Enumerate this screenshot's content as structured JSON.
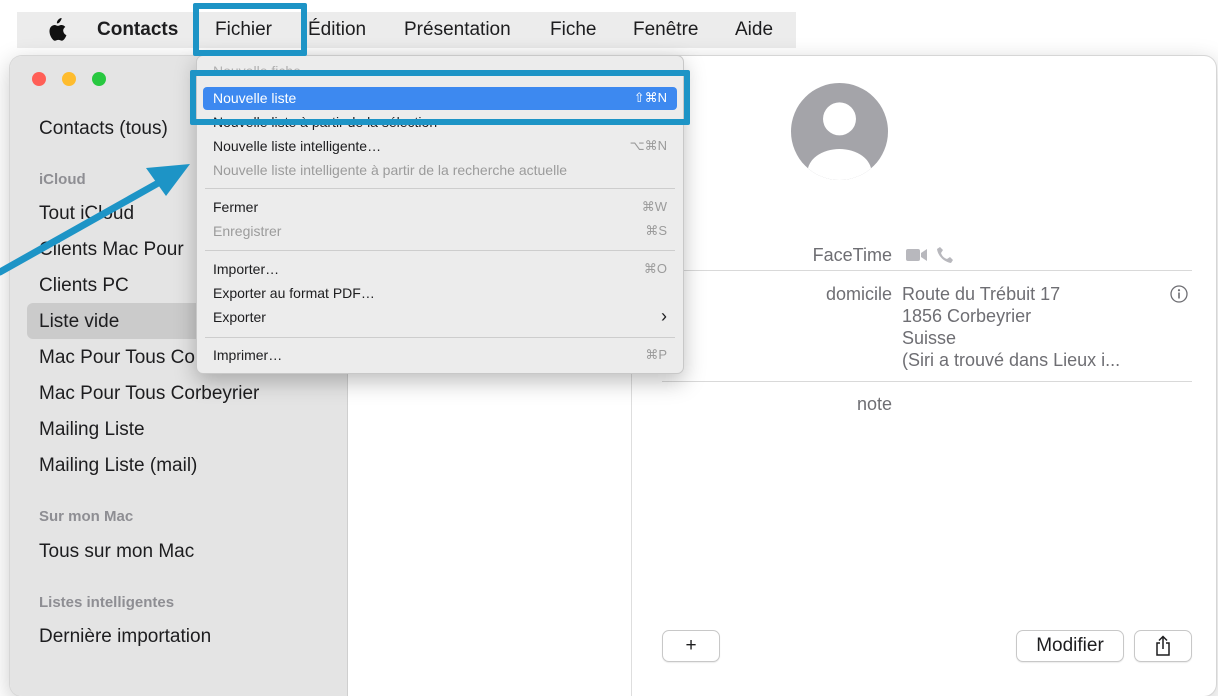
{
  "menubar": {
    "app_name": "Contacts",
    "items": [
      "Fichier",
      "Édition",
      "Présentation",
      "Fiche",
      "Fenêtre",
      "Aide"
    ]
  },
  "sidebar": {
    "all_contacts": "Contacts (tous)",
    "icloud_header": "iCloud",
    "icloud_items": [
      "Tout iCloud",
      "Clients Mac Pour",
      "Clients PC",
      "Liste vide",
      "Mac Pour Tous Co",
      "Mac Pour Tous Corbeyrier",
      "Mailing Liste",
      "Mailing Liste (mail)"
    ],
    "mac_header": "Sur mon Mac",
    "mac_items": [
      "Tous sur mon Mac"
    ],
    "smart_header": "Listes intelligentes",
    "smart_items": [
      "Dernière importation"
    ],
    "selected_item": "Liste vide"
  },
  "file_menu": {
    "hidden_top": "Nouvelle fiche",
    "highlighted": {
      "label": "Nouvelle liste",
      "shortcut": "⇧⌘N"
    },
    "items": [
      {
        "label": "Nouvelle liste à partir de la sélection",
        "shortcut": "",
        "enabled": true
      },
      {
        "label": "Nouvelle liste intelligente…",
        "shortcut": "⌥⌘N",
        "enabled": true
      },
      {
        "label": "Nouvelle liste intelligente à partir de la recherche actuelle",
        "shortcut": "",
        "enabled": false
      },
      {
        "label": "Fermer",
        "shortcut": "⌘W",
        "enabled": true
      },
      {
        "label": "Enregistrer",
        "shortcut": "⌘S",
        "enabled": false
      },
      {
        "label": "Importer…",
        "shortcut": "⌘O",
        "enabled": true
      },
      {
        "label": "Exporter au format PDF…",
        "shortcut": "",
        "enabled": true
      },
      {
        "label": "Exporter",
        "shortcut": "›",
        "enabled": true
      },
      {
        "label": "Imprimer…",
        "shortcut": "⌘P",
        "enabled": true
      }
    ]
  },
  "detail": {
    "facetime_label": "FaceTime",
    "home_label": "domicile",
    "address_lines": [
      "Route du Trébuit 17",
      "1856 Corbeyrier",
      "Suisse",
      "(Siri a trouvé dans Lieux i..."
    ],
    "note_label": "note",
    "add_button": "+",
    "edit_button": "Modifier"
  },
  "annotation": {
    "color": "#1d94c6"
  }
}
